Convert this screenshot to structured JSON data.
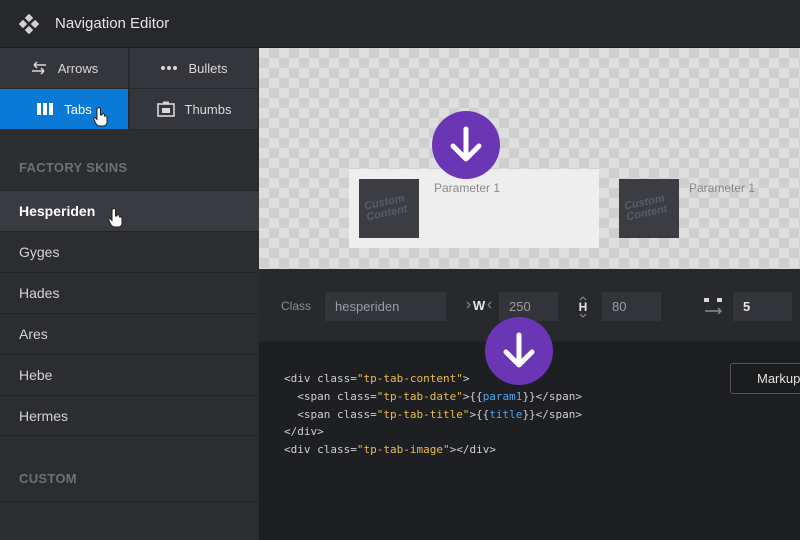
{
  "header": {
    "title": "Navigation Editor",
    "icon": "gamepad-icon"
  },
  "nav_types": [
    {
      "label": "Arrows",
      "icon": "arrows-icon",
      "active": false
    },
    {
      "label": "Bullets",
      "icon": "bullets-icon",
      "active": false
    },
    {
      "label": "Tabs",
      "icon": "tabs-icon",
      "active": true
    },
    {
      "label": "Thumbs",
      "icon": "thumbs-icon",
      "active": false
    }
  ],
  "factory_skins": {
    "title": "FACTORY SKINS",
    "items": [
      "Hesperiden",
      "Gyges",
      "Hades",
      "Ares",
      "Hebe",
      "Hermes"
    ],
    "selected": "Hesperiden"
  },
  "custom": {
    "title": "CUSTOM"
  },
  "preview": {
    "tabs": [
      {
        "param": "Parameter 1",
        "thumb_text": "Custom Content",
        "active": true
      },
      {
        "param": "Parameter 1",
        "thumb_text": "Custom Content",
        "active": false
      }
    ]
  },
  "settings": {
    "class_label": "Class",
    "class_value": "hesperiden",
    "width_label": "W",
    "width_value": "250",
    "height_label": "H",
    "height_value": "80",
    "spacing_value": "5"
  },
  "code": {
    "markup_button": "Markup"
  },
  "colors": {
    "accent": "#0b7ad6",
    "arrow_badge": "#6b36b6",
    "code_string": "#e8bd4f",
    "code_var": "#4ea6e8"
  }
}
